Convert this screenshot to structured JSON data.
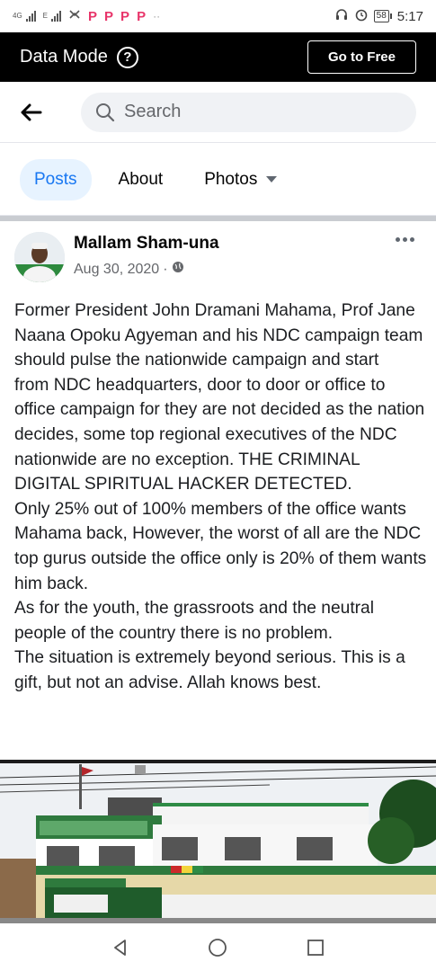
{
  "status_bar": {
    "network_labels": [
      "4G",
      "E"
    ],
    "app_indicators": [
      "P",
      "P",
      "P",
      "P"
    ],
    "more_dots": "··",
    "battery": "58",
    "time": "5:17",
    "icons": [
      "signal-icon",
      "usb-icon",
      "headset-icon",
      "alarm-icon",
      "battery-icon"
    ]
  },
  "data_bar": {
    "label": "Data Mode",
    "help_icon": "?",
    "button_label": "Go to Free"
  },
  "search": {
    "placeholder": "Search"
  },
  "tabs": [
    {
      "label": "Posts",
      "active": true
    },
    {
      "label": "About",
      "active": false
    },
    {
      "label": "Photos",
      "active": false
    }
  ],
  "post": {
    "author": "Mallam Sham-una",
    "date": "Aug 30, 2020",
    "separator": "·",
    "privacy_icon": "globe-icon",
    "text": "Former President John Dramani Mahama, Prof Jane Naana Opoku Agyeman and his  NDC campaign team should pulse the nationwide campaign and start\nfrom NDC headquarters, door to door or office to office campaign for they are not decided as the nation decides, some top regional executives of the NDC nationwide are no exception. THE CRIMINAL DIGITAL SPIRITUAL HACKER DETECTED.\nOnly 25% out of 100% members of the office wants Mahama back, However, the worst of all are the NDC top gurus outside the office only is 20% of them wants him back.\nAs for the youth, the grassroots  and the neutral people of the country there is no problem.\nThe situation is extremely beyond serious. This is a gift, but not an advise. Allah knows best."
  },
  "colors": {
    "accent": "#1877f2",
    "tab_active_bg": "#e7f3ff",
    "data_bar_bg": "#000000",
    "search_bg": "#f0f2f5"
  }
}
